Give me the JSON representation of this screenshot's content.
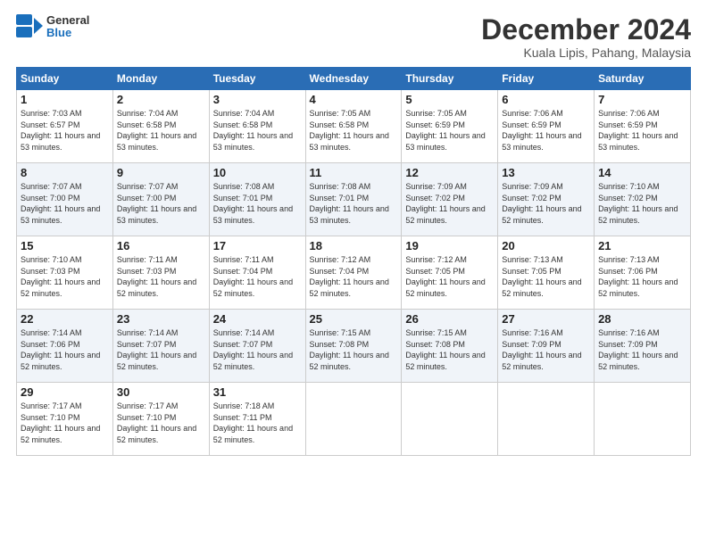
{
  "logo": {
    "text_general": "General",
    "text_blue": "Blue"
  },
  "title": "December 2024",
  "location": "Kuala Lipis, Pahang, Malaysia",
  "days_header": [
    "Sunday",
    "Monday",
    "Tuesday",
    "Wednesday",
    "Thursday",
    "Friday",
    "Saturday"
  ],
  "weeks": [
    [
      {
        "day": "1",
        "sunrise": "7:03 AM",
        "sunset": "6:57 PM",
        "daylight": "11 hours and 53 minutes."
      },
      {
        "day": "2",
        "sunrise": "7:04 AM",
        "sunset": "6:58 PM",
        "daylight": "11 hours and 53 minutes."
      },
      {
        "day": "3",
        "sunrise": "7:04 AM",
        "sunset": "6:58 PM",
        "daylight": "11 hours and 53 minutes."
      },
      {
        "day": "4",
        "sunrise": "7:05 AM",
        "sunset": "6:58 PM",
        "daylight": "11 hours and 53 minutes."
      },
      {
        "day": "5",
        "sunrise": "7:05 AM",
        "sunset": "6:59 PM",
        "daylight": "11 hours and 53 minutes."
      },
      {
        "day": "6",
        "sunrise": "7:06 AM",
        "sunset": "6:59 PM",
        "daylight": "11 hours and 53 minutes."
      },
      {
        "day": "7",
        "sunrise": "7:06 AM",
        "sunset": "6:59 PM",
        "daylight": "11 hours and 53 minutes."
      }
    ],
    [
      {
        "day": "8",
        "sunrise": "7:07 AM",
        "sunset": "7:00 PM",
        "daylight": "11 hours and 53 minutes."
      },
      {
        "day": "9",
        "sunrise": "7:07 AM",
        "sunset": "7:00 PM",
        "daylight": "11 hours and 53 minutes."
      },
      {
        "day": "10",
        "sunrise": "7:08 AM",
        "sunset": "7:01 PM",
        "daylight": "11 hours and 53 minutes."
      },
      {
        "day": "11",
        "sunrise": "7:08 AM",
        "sunset": "7:01 PM",
        "daylight": "11 hours and 53 minutes."
      },
      {
        "day": "12",
        "sunrise": "7:09 AM",
        "sunset": "7:02 PM",
        "daylight": "11 hours and 52 minutes."
      },
      {
        "day": "13",
        "sunrise": "7:09 AM",
        "sunset": "7:02 PM",
        "daylight": "11 hours and 52 minutes."
      },
      {
        "day": "14",
        "sunrise": "7:10 AM",
        "sunset": "7:02 PM",
        "daylight": "11 hours and 52 minutes."
      }
    ],
    [
      {
        "day": "15",
        "sunrise": "7:10 AM",
        "sunset": "7:03 PM",
        "daylight": "11 hours and 52 minutes."
      },
      {
        "day": "16",
        "sunrise": "7:11 AM",
        "sunset": "7:03 PM",
        "daylight": "11 hours and 52 minutes."
      },
      {
        "day": "17",
        "sunrise": "7:11 AM",
        "sunset": "7:04 PM",
        "daylight": "11 hours and 52 minutes."
      },
      {
        "day": "18",
        "sunrise": "7:12 AM",
        "sunset": "7:04 PM",
        "daylight": "11 hours and 52 minutes."
      },
      {
        "day": "19",
        "sunrise": "7:12 AM",
        "sunset": "7:05 PM",
        "daylight": "11 hours and 52 minutes."
      },
      {
        "day": "20",
        "sunrise": "7:13 AM",
        "sunset": "7:05 PM",
        "daylight": "11 hours and 52 minutes."
      },
      {
        "day": "21",
        "sunrise": "7:13 AM",
        "sunset": "7:06 PM",
        "daylight": "11 hours and 52 minutes."
      }
    ],
    [
      {
        "day": "22",
        "sunrise": "7:14 AM",
        "sunset": "7:06 PM",
        "daylight": "11 hours and 52 minutes."
      },
      {
        "day": "23",
        "sunrise": "7:14 AM",
        "sunset": "7:07 PM",
        "daylight": "11 hours and 52 minutes."
      },
      {
        "day": "24",
        "sunrise": "7:14 AM",
        "sunset": "7:07 PM",
        "daylight": "11 hours and 52 minutes."
      },
      {
        "day": "25",
        "sunrise": "7:15 AM",
        "sunset": "7:08 PM",
        "daylight": "11 hours and 52 minutes."
      },
      {
        "day": "26",
        "sunrise": "7:15 AM",
        "sunset": "7:08 PM",
        "daylight": "11 hours and 52 minutes."
      },
      {
        "day": "27",
        "sunrise": "7:16 AM",
        "sunset": "7:09 PM",
        "daylight": "11 hours and 52 minutes."
      },
      {
        "day": "28",
        "sunrise": "7:16 AM",
        "sunset": "7:09 PM",
        "daylight": "11 hours and 52 minutes."
      }
    ],
    [
      {
        "day": "29",
        "sunrise": "7:17 AM",
        "sunset": "7:10 PM",
        "daylight": "11 hours and 52 minutes."
      },
      {
        "day": "30",
        "sunrise": "7:17 AM",
        "sunset": "7:10 PM",
        "daylight": "11 hours and 52 minutes."
      },
      {
        "day": "31",
        "sunrise": "7:18 AM",
        "sunset": "7:11 PM",
        "daylight": "11 hours and 52 minutes."
      },
      null,
      null,
      null,
      null
    ]
  ]
}
